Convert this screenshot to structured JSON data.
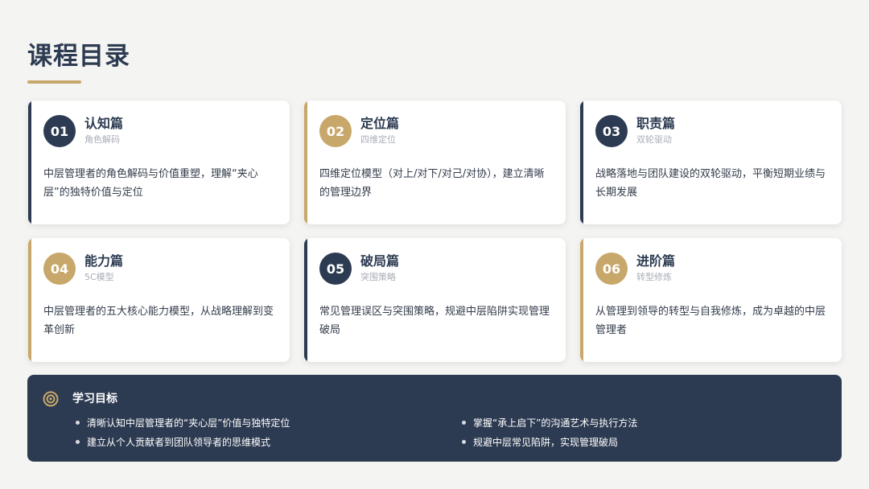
{
  "page": {
    "title": "课程目录"
  },
  "colors": {
    "navy": "#2d3b52",
    "gold": "#c8a86a",
    "background": "#f4f4f2"
  },
  "cards": [
    {
      "number": "01",
      "title": "认知篇",
      "subtitle": "角色解码",
      "description": "中层管理者的角色解码与价值重塑，理解“夹心层”的独特价值与定位",
      "accent": "navy"
    },
    {
      "number": "02",
      "title": "定位篇",
      "subtitle": "四维定位",
      "description": "四维定位模型（对上/对下/对己/对协），建立清晰的管理边界",
      "accent": "gold"
    },
    {
      "number": "03",
      "title": "职责篇",
      "subtitle": "双轮驱动",
      "description": "战略落地与团队建设的双轮驱动，平衡短期业绩与长期发展",
      "accent": "navy"
    },
    {
      "number": "04",
      "title": "能力篇",
      "subtitle": "5C模型",
      "description": "中层管理者的五大核心能力模型，从战略理解到变革创新",
      "accent": "gold"
    },
    {
      "number": "05",
      "title": "破局篇",
      "subtitle": "突围策略",
      "description": "常见管理误区与突围策略，规避中层陷阱实现管理破局",
      "accent": "navy"
    },
    {
      "number": "06",
      "title": "进阶篇",
      "subtitle": "转型修炼",
      "description": "从管理到领导的转型与自我修炼，成为卓越的中层管理者",
      "accent": "gold"
    }
  ],
  "goals": {
    "icon": "target-icon",
    "title": "学习目标",
    "items": [
      "清晰认知中层管理者的“夹心层”价值与独特定位",
      "掌握“承上启下”的沟通艺术与执行方法",
      "建立从个人贡献者到团队领导者的思维模式",
      "规避中层常见陷阱，实现管理破局"
    ]
  }
}
